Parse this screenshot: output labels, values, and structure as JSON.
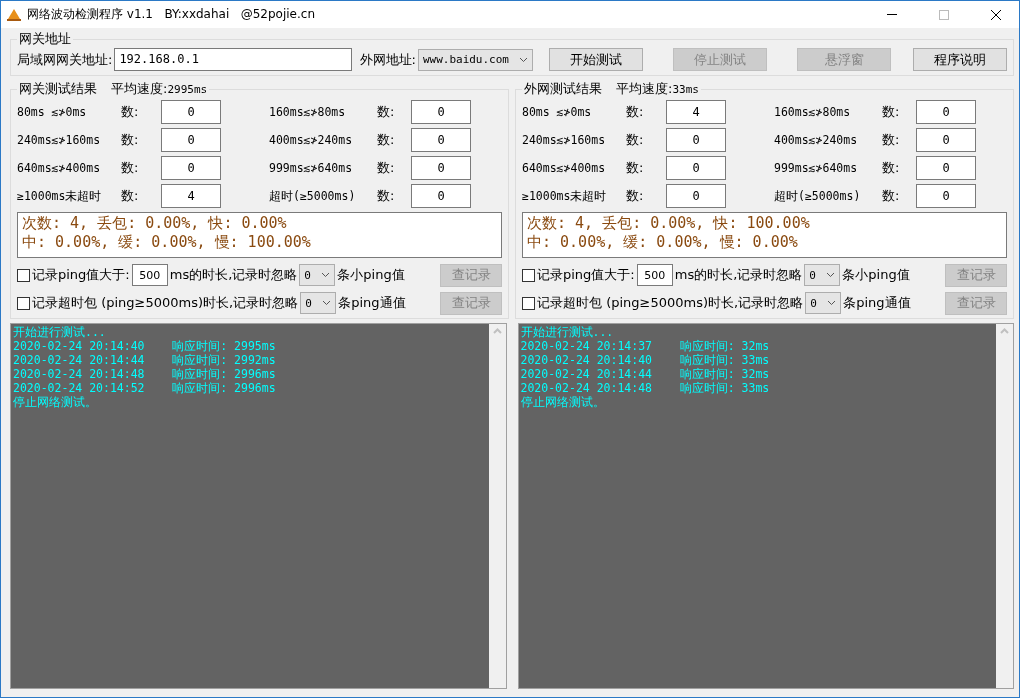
{
  "window": {
    "title": "网络波动检测程序 v1.1   BY:xxdahai   @52pojie.cn"
  },
  "gateway_group": {
    "title": "网关地址",
    "lan_label": "局域网网关地址:",
    "lan_value": "192.168.0.1",
    "wan_label": "外网地址:",
    "wan_value": "www.baidu.com"
  },
  "buttons": [
    {
      "label": "开始测试",
      "disabled": false
    },
    {
      "label": "停止测试",
      "disabled": true
    },
    {
      "label": "悬浮窗",
      "disabled": true
    },
    {
      "label": "程序说明",
      "disabled": false
    }
  ],
  "panels": [
    {
      "title": "网关测试结果",
      "avg_label": "平均速度:",
      "avg_value": "2995ms",
      "ranges": [
        {
          "label": "80ms ≲≯0ms",
          "count_label": "数:",
          "value": "0"
        },
        {
          "label": "160ms≲≯80ms",
          "count_label": "数:",
          "value": "0"
        },
        {
          "label": "240ms≲≯160ms",
          "count_label": "数:",
          "value": "0"
        },
        {
          "label": "400ms≲≯240ms",
          "count_label": "数:",
          "value": "0"
        },
        {
          "label": "640ms≲≯400ms",
          "count_label": "数:",
          "value": "0"
        },
        {
          "label": "999ms≲≯640ms",
          "count_label": "数:",
          "value": "0"
        },
        {
          "label": "≥1000ms未超时",
          "count_label": "数:",
          "value": "4"
        },
        {
          "label": "超时(≥5000ms)",
          "count_label": "数:",
          "value": "0"
        }
      ],
      "summary": [
        "次数: 4, 丢包: 0.00%, 快: 0.00%",
        "中: 0.00%, 缓: 0.00%, 慢: 100.00%"
      ],
      "options": [
        {
          "kind": "threshold",
          "checked": false,
          "label": "记录ping值大于:",
          "input": "500",
          "middle": "ms的时长,记录时忽略",
          "select": "0",
          "tail": "条小ping值",
          "button": {
            "label": "查记录",
            "disabled": true
          }
        },
        {
          "kind": "timeout",
          "checked": false,
          "label": "记录超时包 (ping≥5000ms)时长,记录时忽略",
          "select": "0",
          "tail": "条ping通值",
          "button": {
            "label": "查记录",
            "disabled": true
          }
        }
      ],
      "log": [
        "开始进行测试...",
        "2020-02-24 20:14:40    响应时间: 2995ms",
        "2020-02-24 20:14:44    响应时间: 2992ms",
        "2020-02-24 20:14:48    响应时间: 2996ms",
        "2020-02-24 20:14:52    响应时间: 2996ms",
        "停止网络测试。"
      ]
    },
    {
      "title": "外网测试结果",
      "avg_label": "平均速度:",
      "avg_value": "33ms",
      "ranges": [
        {
          "label": "80ms ≲≯0ms",
          "count_label": "数:",
          "value": "4"
        },
        {
          "label": "160ms≲≯80ms",
          "count_label": "数:",
          "value": "0"
        },
        {
          "label": "240ms≲≯160ms",
          "count_label": "数:",
          "value": "0"
        },
        {
          "label": "400ms≲≯240ms",
          "count_label": "数:",
          "value": "0"
        },
        {
          "label": "640ms≲≯400ms",
          "count_label": "数:",
          "value": "0"
        },
        {
          "label": "999ms≲≯640ms",
          "count_label": "数:",
          "value": "0"
        },
        {
          "label": "≥1000ms未超时",
          "count_label": "数:",
          "value": "0"
        },
        {
          "label": "超时(≥5000ms)",
          "count_label": "数:",
          "value": "0"
        }
      ],
      "summary": [
        "次数: 4, 丢包: 0.00%, 快: 100.00%",
        "中: 0.00%, 缓: 0.00%, 慢: 0.00%"
      ],
      "options": [
        {
          "kind": "threshold",
          "checked": false,
          "label": "记录ping值大于:",
          "input": "500",
          "middle": "ms的时长,记录时忽略",
          "select": "0",
          "tail": "条小ping值",
          "button": {
            "label": "查记录",
            "disabled": true
          }
        },
        {
          "kind": "timeout",
          "checked": false,
          "label": "记录超时包 (ping≥5000ms)时长,记录时忽略",
          "select": "0",
          "tail": "条ping通值",
          "button": {
            "label": "查记录",
            "disabled": true
          }
        }
      ],
      "log": [
        "开始进行测试...",
        "2020-02-24 20:14:37    响应时间: 32ms",
        "2020-02-24 20:14:40    响应时间: 33ms",
        "2020-02-24 20:14:44    响应时间: 32ms",
        "2020-02-24 20:14:48    响应时间: 33ms",
        "停止网络测试。"
      ]
    }
  ]
}
